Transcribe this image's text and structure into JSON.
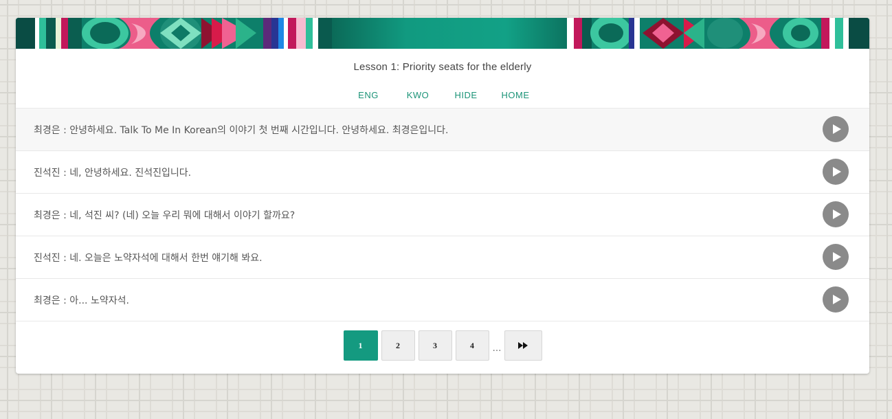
{
  "lesson": {
    "title": "Lesson 1: Priority seats for the elderly"
  },
  "nav": {
    "eng": "ENG",
    "kwo": "KWO",
    "hide": "HIDE",
    "home": "HOME"
  },
  "rows": [
    {
      "text": "최경은 : 안녕하세요. Talk To Me In Korean의 이야기 첫 번째 시간입니다. 안녕하세요. 최경은입니다."
    },
    {
      "text": "진석진 : 네, 안녕하세요. 진석진입니다."
    },
    {
      "text": "최경은 : 네, 석진 씨? (네) 오늘 우리 뭐에 대해서 이야기 할까요?"
    },
    {
      "text": "진석진 : 네. 오늘은 노약자석에 대해서 한번 얘기해 봐요."
    },
    {
      "text": "최경은 : 아... 노약자석."
    }
  ],
  "pagination": {
    "pages": [
      "1",
      "2",
      "3",
      "4"
    ],
    "ellipsis": "…",
    "current": "1"
  },
  "colors": {
    "accent": "#149a80",
    "play": "#8a8a8a"
  }
}
